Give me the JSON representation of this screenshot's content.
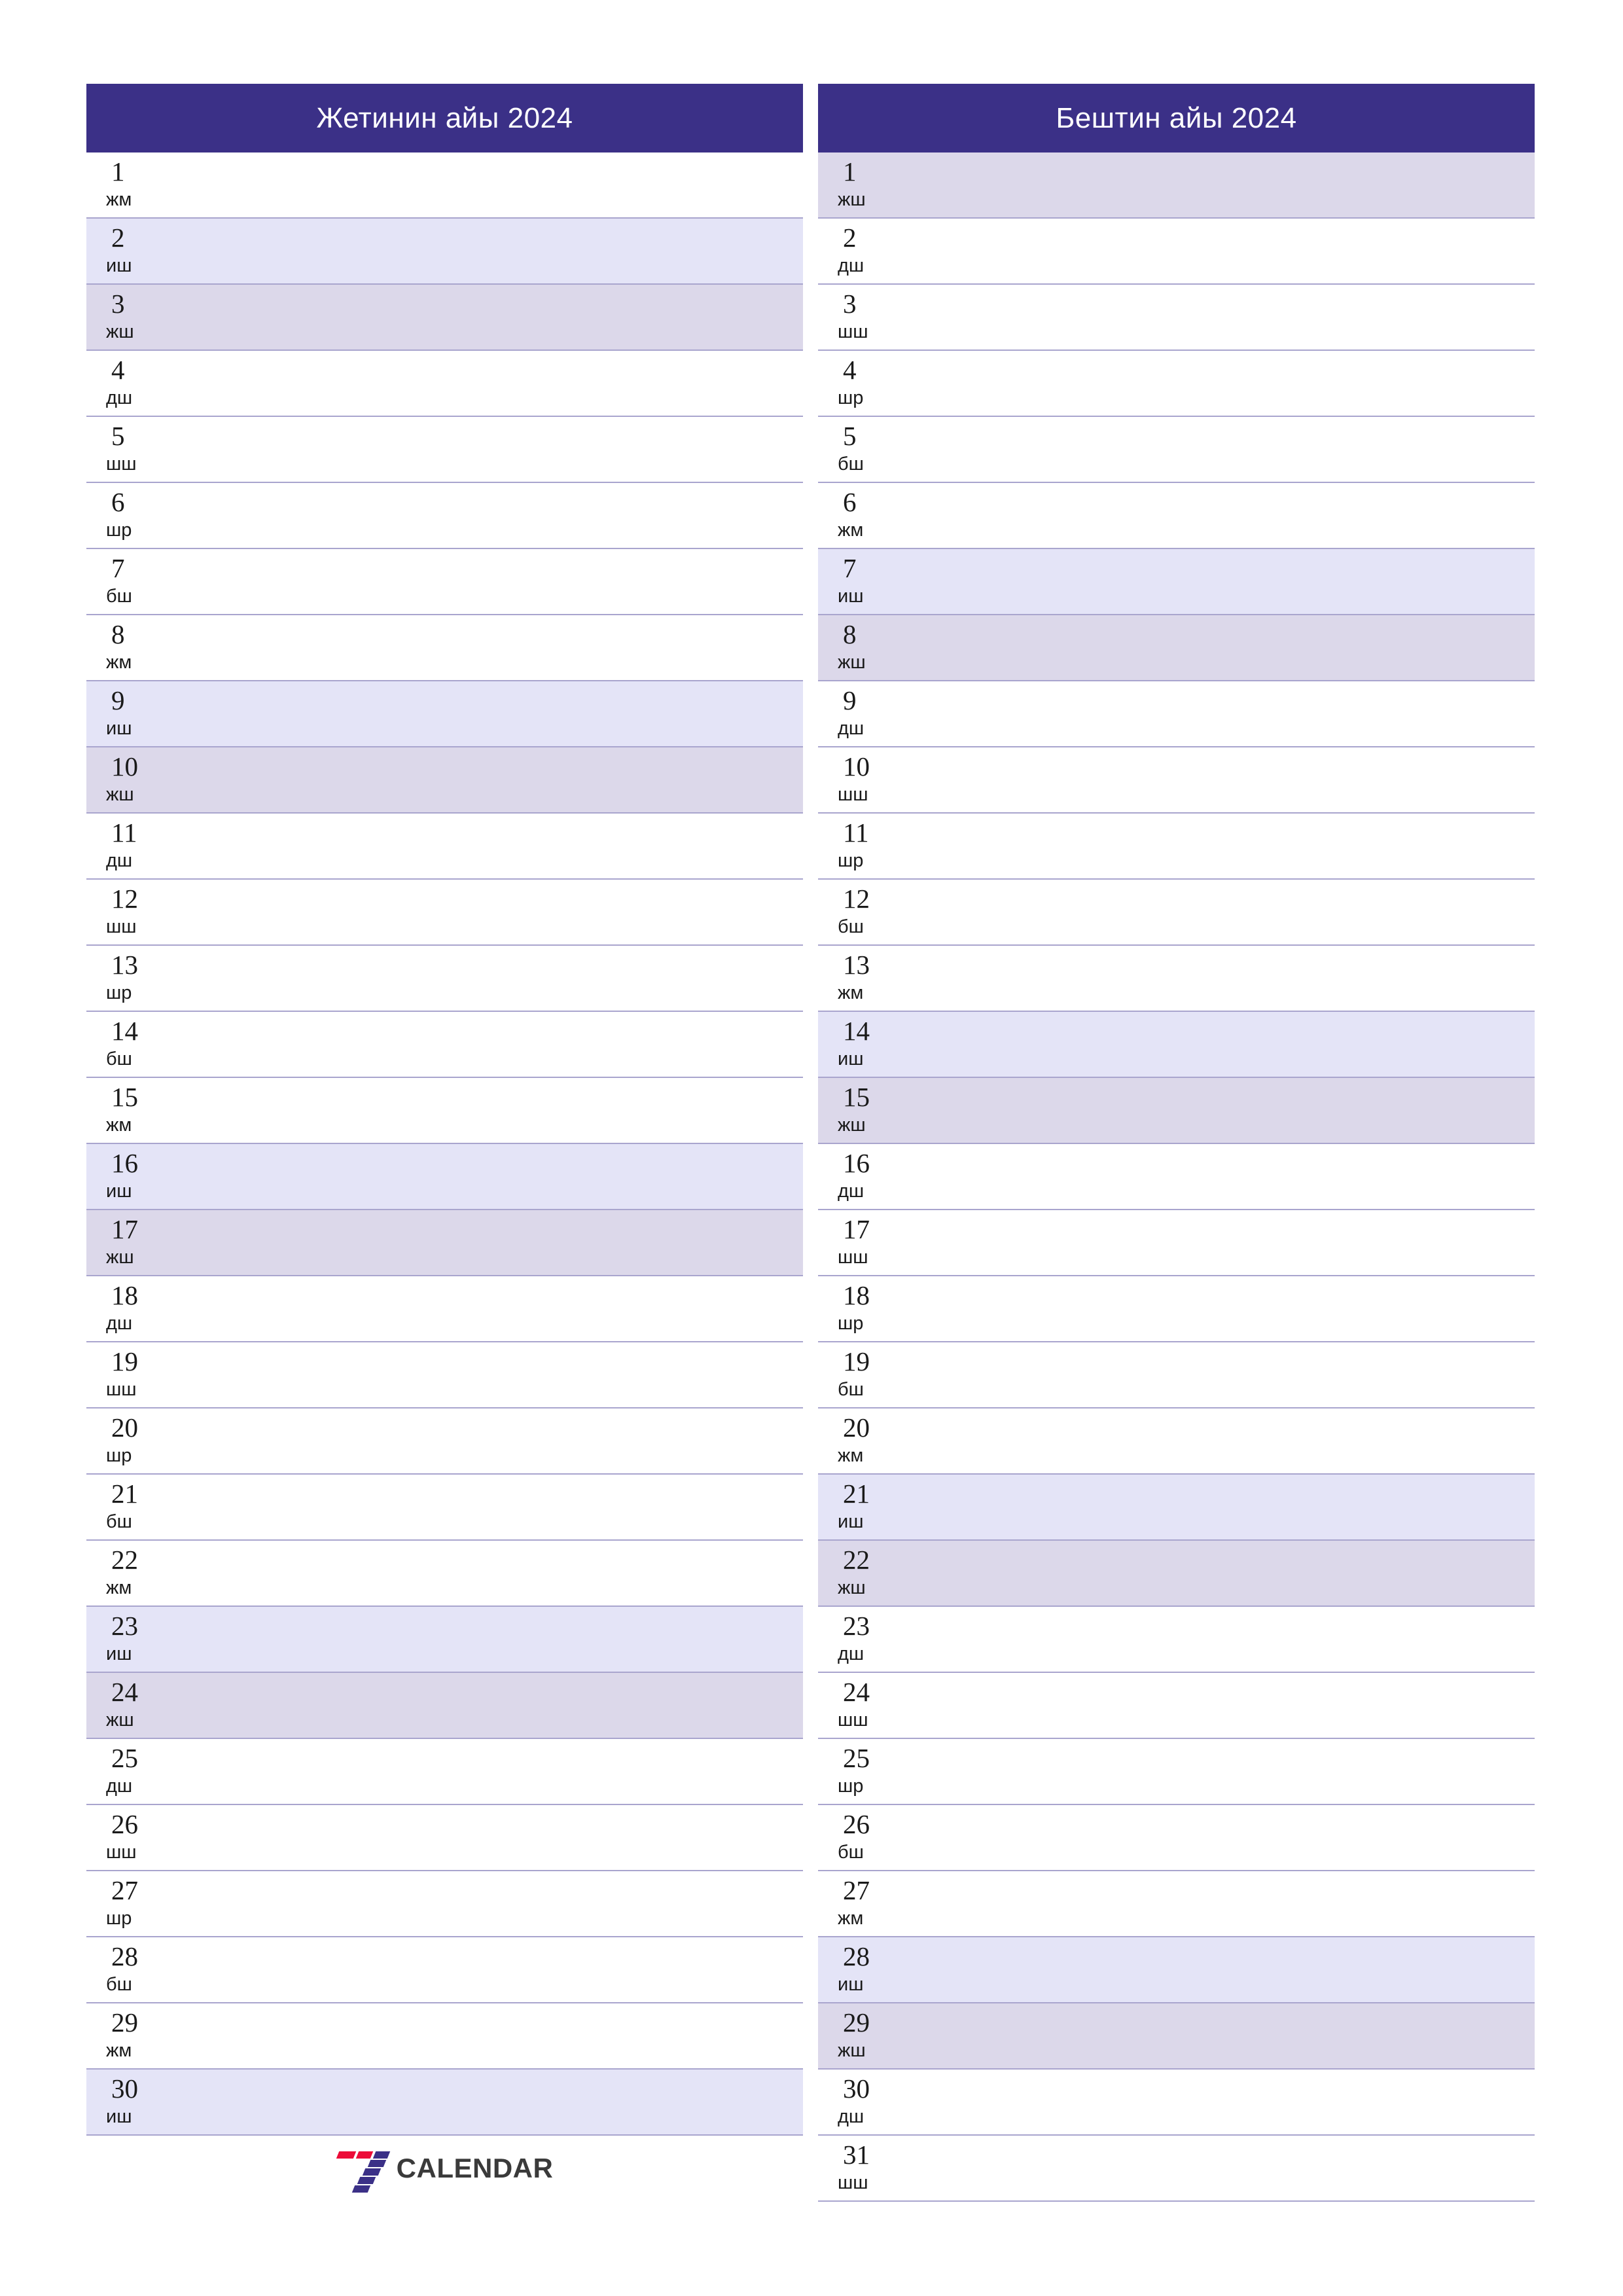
{
  "document": {
    "type": "two-month-planner",
    "year": "2024",
    "colors": {
      "header_background": "#3b3087",
      "header_text": "#ffffff",
      "saturday_background": "#e4e4f7",
      "sunday_background": "#dcd8ea",
      "weekday_background": "#ffffff",
      "grid_line": "#a9a5ce",
      "logo_red": "#ec0c38",
      "logo_purple": "#3b3087",
      "logo_text": "#3a3a3a"
    }
  },
  "panels": [
    {
      "title": "Жетинин айы 2024",
      "days": [
        {
          "num": "1",
          "dow": "жм",
          "type": "weekday"
        },
        {
          "num": "2",
          "dow": "иш",
          "type": "saturday"
        },
        {
          "num": "3",
          "dow": "жш",
          "type": "sunday"
        },
        {
          "num": "4",
          "dow": "дш",
          "type": "weekday"
        },
        {
          "num": "5",
          "dow": "шш",
          "type": "weekday"
        },
        {
          "num": "6",
          "dow": "шр",
          "type": "weekday"
        },
        {
          "num": "7",
          "dow": "бш",
          "type": "weekday"
        },
        {
          "num": "8",
          "dow": "жм",
          "type": "weekday"
        },
        {
          "num": "9",
          "dow": "иш",
          "type": "saturday"
        },
        {
          "num": "10",
          "dow": "жш",
          "type": "sunday"
        },
        {
          "num": "11",
          "dow": "дш",
          "type": "weekday"
        },
        {
          "num": "12",
          "dow": "шш",
          "type": "weekday"
        },
        {
          "num": "13",
          "dow": "шр",
          "type": "weekday"
        },
        {
          "num": "14",
          "dow": "бш",
          "type": "weekday"
        },
        {
          "num": "15",
          "dow": "жм",
          "type": "weekday"
        },
        {
          "num": "16",
          "dow": "иш",
          "type": "saturday"
        },
        {
          "num": "17",
          "dow": "жш",
          "type": "sunday"
        },
        {
          "num": "18",
          "dow": "дш",
          "type": "weekday"
        },
        {
          "num": "19",
          "dow": "шш",
          "type": "weekday"
        },
        {
          "num": "20",
          "dow": "шр",
          "type": "weekday"
        },
        {
          "num": "21",
          "dow": "бш",
          "type": "weekday"
        },
        {
          "num": "22",
          "dow": "жм",
          "type": "weekday"
        },
        {
          "num": "23",
          "dow": "иш",
          "type": "saturday"
        },
        {
          "num": "24",
          "dow": "жш",
          "type": "sunday"
        },
        {
          "num": "25",
          "dow": "дш",
          "type": "weekday"
        },
        {
          "num": "26",
          "dow": "шш",
          "type": "weekday"
        },
        {
          "num": "27",
          "dow": "шр",
          "type": "weekday"
        },
        {
          "num": "28",
          "dow": "бш",
          "type": "weekday"
        },
        {
          "num": "29",
          "dow": "жм",
          "type": "weekday"
        },
        {
          "num": "30",
          "dow": "иш",
          "type": "saturday"
        }
      ]
    },
    {
      "title": "Бештин айы 2024",
      "days": [
        {
          "num": "1",
          "dow": "жш",
          "type": "sunday"
        },
        {
          "num": "2",
          "dow": "дш",
          "type": "weekday"
        },
        {
          "num": "3",
          "dow": "шш",
          "type": "weekday"
        },
        {
          "num": "4",
          "dow": "шр",
          "type": "weekday"
        },
        {
          "num": "5",
          "dow": "бш",
          "type": "weekday"
        },
        {
          "num": "6",
          "dow": "жм",
          "type": "weekday"
        },
        {
          "num": "7",
          "dow": "иш",
          "type": "saturday"
        },
        {
          "num": "8",
          "dow": "жш",
          "type": "sunday"
        },
        {
          "num": "9",
          "dow": "дш",
          "type": "weekday"
        },
        {
          "num": "10",
          "dow": "шш",
          "type": "weekday"
        },
        {
          "num": "11",
          "dow": "шр",
          "type": "weekday"
        },
        {
          "num": "12",
          "dow": "бш",
          "type": "weekday"
        },
        {
          "num": "13",
          "dow": "жм",
          "type": "weekday"
        },
        {
          "num": "14",
          "dow": "иш",
          "type": "saturday"
        },
        {
          "num": "15",
          "dow": "жш",
          "type": "sunday"
        },
        {
          "num": "16",
          "dow": "дш",
          "type": "weekday"
        },
        {
          "num": "17",
          "dow": "шш",
          "type": "weekday"
        },
        {
          "num": "18",
          "dow": "шр",
          "type": "weekday"
        },
        {
          "num": "19",
          "dow": "бш",
          "type": "weekday"
        },
        {
          "num": "20",
          "dow": "жм",
          "type": "weekday"
        },
        {
          "num": "21",
          "dow": "иш",
          "type": "saturday"
        },
        {
          "num": "22",
          "dow": "жш",
          "type": "sunday"
        },
        {
          "num": "23",
          "dow": "дш",
          "type": "weekday"
        },
        {
          "num": "24",
          "dow": "шш",
          "type": "weekday"
        },
        {
          "num": "25",
          "dow": "шр",
          "type": "weekday"
        },
        {
          "num": "26",
          "dow": "бш",
          "type": "weekday"
        },
        {
          "num": "27",
          "dow": "жм",
          "type": "weekday"
        },
        {
          "num": "28",
          "dow": "иш",
          "type": "saturday"
        },
        {
          "num": "29",
          "dow": "жш",
          "type": "sunday"
        },
        {
          "num": "30",
          "dow": "дш",
          "type": "weekday"
        },
        {
          "num": "31",
          "dow": "шш",
          "type": "weekday"
        }
      ]
    }
  ],
  "logo": {
    "text": "CALENDAR",
    "mark": "seven-logo-icon"
  }
}
